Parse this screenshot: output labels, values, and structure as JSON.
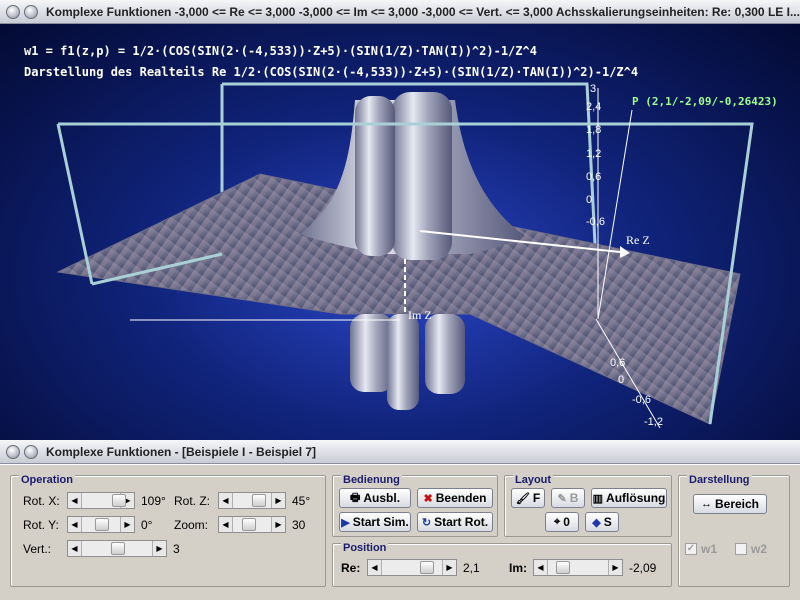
{
  "window": {
    "title": "Komplexe Funktionen  -3,000 <= Re <= 3,000  -3,000 <= Im <= 3,000  -3,000 <= Vert. <= 3,000  Achsskalierungseinheiten:  Re: 0,300 LE   I..."
  },
  "plot": {
    "formula_line1": "w1 = f1(z,p) = 1/2·(COS(SIN(2·(-4,533))·Z+5)·(SIN(1/Z)·TAN(I))^2)-1/Z^4",
    "formula_line2": "Darstellung des Realteils Re 1/2·(COS(SIN(2·(-4,533))·Z+5)·(SIN(1/Z)·TAN(I))^2)-1/Z^4",
    "point_label": "P (2,1/-2,09/-0,26423)",
    "re_axis_label": "Re Z",
    "im_axis_label": "Im Z",
    "vertical_ticks": [
      "3",
      "2,4",
      "1,8",
      "1,2",
      "0,6",
      "0",
      "-0,6"
    ],
    "im_ticks": [
      "0,6",
      "0",
      "-0,6",
      "-1,2"
    ],
    "colors": {
      "background": "#10237a",
      "frame": "#a9d0d6",
      "surface": "#6f7390",
      "point": "#9dff8d"
    }
  },
  "lower_window": {
    "title": "Komplexe Funktionen - [Beispiele I - Beispiel 7]"
  },
  "operation": {
    "title": "Operation",
    "rot_x_label": "Rot. X:",
    "rot_x_value": "109°",
    "rot_y_label": "Rot. Y:",
    "rot_y_value": "0°",
    "vert_label": "Vert.:",
    "vert_value": "3",
    "rot_z_label": "Rot. Z:",
    "rot_z_value": "45°",
    "zoom_label": "Zoom:",
    "zoom_value": "30"
  },
  "bedienung": {
    "title": "Bedienung",
    "ausbl": "Ausbl.",
    "beenden": "Beenden",
    "start_sim": "Start Sim.",
    "start_rot": "Start Rot."
  },
  "layout": {
    "title": "Layout",
    "f": "F",
    "b": "B",
    "aufloesung": "Auflösung",
    "null": "0",
    "s": "S"
  },
  "darstellung": {
    "title": "Darstellung",
    "bereich": "Bereich",
    "w1": "w1",
    "w2": "w2"
  },
  "position": {
    "title": "Position",
    "re_label": "Re:",
    "re_value": "2,1",
    "im_label": "Im:",
    "im_value": "-2,09"
  }
}
